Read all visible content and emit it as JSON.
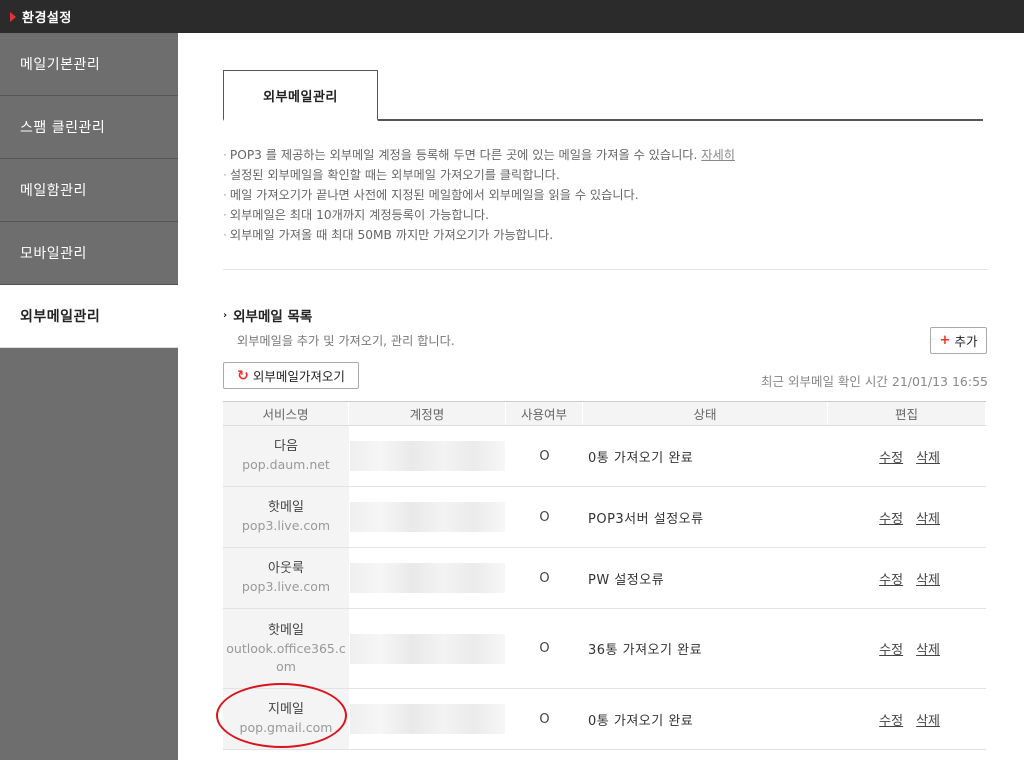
{
  "header": {
    "title": "환경설정",
    "accent": "#e8332c"
  },
  "sidebar": {
    "items": [
      {
        "label": "메일기본관리",
        "active": false
      },
      {
        "label": "스팸 클린관리",
        "active": false
      },
      {
        "label": "메일함관리",
        "active": false
      },
      {
        "label": "모바일관리",
        "active": false
      },
      {
        "label": "외부메일관리",
        "active": true
      }
    ]
  },
  "tab": {
    "label": "외부메일관리"
  },
  "notes": [
    {
      "text": "POP3 를 제공하는 외부메일 계정을 등록해 두면 다른 곳에 있는 메일을 가져올 수 있습니다. ",
      "link": "자세히"
    },
    {
      "text": "설정된 외부메일을 확인할 때는 외부메일 가져오기를 클릭합니다."
    },
    {
      "text": "메일 가져오기가 끝나면 사전에 지정된 메일함에서 외부메일을 읽을 수 있습니다."
    },
    {
      "text": "외부메일은 최대 10개까지 계정등록이 가능합니다."
    },
    {
      "text": "외부메일 가져올 때 최대 50MB 까지만 가져오기가 가능합니다."
    }
  ],
  "list": {
    "title": "외부메일 목록",
    "desc": "외부메일을 추가 및 가져오기, 관리 합니다.",
    "add_label": "추가",
    "fetch_label": "외부메일가져오기",
    "last_check": "최근 외부메일 확인 시간 21/01/13 16:55"
  },
  "table": {
    "headers": [
      "서비스명",
      "계정명",
      "사용여부",
      "상태",
      "편집"
    ],
    "edit_label": "수정",
    "delete_label": "삭제",
    "rows": [
      {
        "name": "다음",
        "host": "pop.daum.net",
        "use": "O",
        "status": "0통 가져오기 완료"
      },
      {
        "name": "핫메일",
        "host": "pop3.live.com",
        "use": "O",
        "status": "POP3서버 설정오류"
      },
      {
        "name": "아웃룩",
        "host": "pop3.live.com",
        "use": "O",
        "status": "PW 설정오류"
      },
      {
        "name": "핫메일",
        "host": "outlook.office365.com",
        "use": "O",
        "status": "36통 가져오기 완료"
      },
      {
        "name": "지메일",
        "host": "pop.gmail.com",
        "use": "O",
        "status": "0통 가져오기 완료"
      }
    ]
  }
}
